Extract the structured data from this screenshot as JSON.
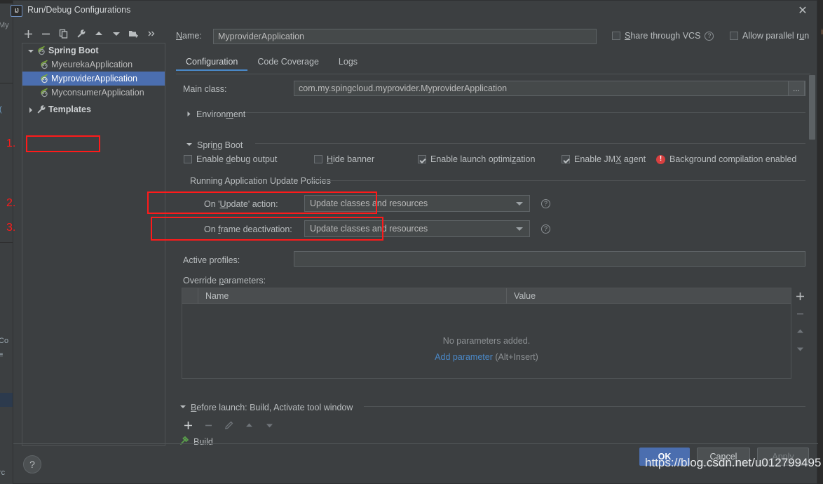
{
  "window": {
    "title": "Run/Debug Configurations",
    "logo": "IJ",
    "close_label": "✕"
  },
  "left_toolbar": {
    "buttons": [
      {
        "name": "add-configuration-button",
        "icon": "plus-icon"
      },
      {
        "name": "remove-configuration-button",
        "icon": "minus-icon"
      },
      {
        "name": "copy-configuration-button",
        "icon": "copy-icon"
      },
      {
        "name": "edit-templates-button",
        "icon": "wrench-icon"
      },
      {
        "name": "move-up-button",
        "icon": "arrow-up-icon"
      },
      {
        "name": "move-down-button",
        "icon": "arrow-down-icon"
      },
      {
        "name": "create-folder-button",
        "icon": "folder-add-icon"
      },
      {
        "name": "more-options-button",
        "icon": "chevron-double-right-icon"
      }
    ]
  },
  "tree": {
    "items": [
      {
        "label": "Spring Boot",
        "level": 0,
        "expanded": true,
        "bold": true,
        "selected": false,
        "icon": "spring-boot-icon"
      },
      {
        "label": "MyeurekaApplication",
        "level": 1,
        "expanded": null,
        "bold": false,
        "selected": false,
        "icon": "spring-boot-icon"
      },
      {
        "label": "MyproviderApplication",
        "level": 1,
        "expanded": null,
        "bold": false,
        "selected": true,
        "icon": "spring-boot-icon"
      },
      {
        "label": "MyconsumerApplication",
        "level": 1,
        "expanded": null,
        "bold": false,
        "selected": false,
        "icon": "spring-boot-icon"
      },
      {
        "label": "Templates",
        "level": 0,
        "expanded": false,
        "bold": true,
        "selected": false,
        "icon": "wrench-icon"
      }
    ]
  },
  "header": {
    "name_label": "Name:",
    "name_value": "MyproviderApplication",
    "share_label": "Share through VCS",
    "share_checked": false,
    "share_help": "?",
    "parallel_label": "Allow parallel run",
    "parallel_checked": false
  },
  "tabs": [
    {
      "label": "Configuration",
      "active": true
    },
    {
      "label": "Code Coverage",
      "active": false
    },
    {
      "label": "Logs",
      "active": false
    }
  ],
  "configuration": {
    "main_class_label": "Main class:",
    "main_class_value": "com.my.spingcloud.myprovider.MyproviderApplication",
    "browse_label": "...",
    "environment_label": "Environment",
    "spring_boot_label": "Spring Boot",
    "checkboxes": [
      {
        "label": "Enable debug output",
        "checked": false
      },
      {
        "label": "Hide banner",
        "checked": false
      },
      {
        "label": "Enable launch optimization",
        "checked": true
      },
      {
        "label": "Enable JMX agent",
        "checked": true
      }
    ],
    "background_warning": "Background compilation enabled",
    "update_policies_label": "Running Application Update Policies",
    "on_update_label": "On 'Update' action:",
    "on_update_value": "Update classes and resources",
    "on_frame_label": "On frame deactivation:",
    "on_frame_value": "Update classes and resources",
    "active_profiles_label": "Active profiles:",
    "active_profiles_value": "",
    "override_params_label": "Override parameters:",
    "table": {
      "columns": [
        "Name",
        "Value"
      ],
      "rows": [],
      "empty_text": "No parameters added.",
      "add_link": "Add parameter",
      "add_hint": "(Alt+Insert)"
    },
    "side_buttons": [
      {
        "name": "add-parameter-button",
        "icon": "plus-icon"
      },
      {
        "name": "remove-parameter-button",
        "icon": "minus-icon"
      },
      {
        "name": "move-parameter-up-button",
        "icon": "arrow-up-icon"
      },
      {
        "name": "move-parameter-down-button",
        "icon": "arrow-down-icon"
      }
    ]
  },
  "before_launch": {
    "header": "Before launch: Build, Activate tool window",
    "toolbar": [
      {
        "name": "before-launch-add-button",
        "icon": "plus-icon"
      },
      {
        "name": "before-launch-remove-button",
        "icon": "minus-icon"
      },
      {
        "name": "before-launch-edit-button",
        "icon": "pencil-icon"
      },
      {
        "name": "before-launch-up-button",
        "icon": "arrow-up-icon"
      },
      {
        "name": "before-launch-down-button",
        "icon": "arrow-down-icon"
      }
    ],
    "task": "Build"
  },
  "footer": {
    "help_label": "?",
    "ok_label": "OK",
    "cancel_label": "Cancel",
    "apply_label": "Apply"
  },
  "annotations": {
    "step1": "1.",
    "step2": "2.",
    "step3": "3."
  },
  "watermark": "https://blog.csdn.net/u012799495",
  "colors": {
    "accent": "#4b6eaf",
    "link": "#4a88c7",
    "annotation": "#ff1a1a",
    "warning": "#d84040",
    "panel": "#3c3f41",
    "field": "#45494a"
  }
}
